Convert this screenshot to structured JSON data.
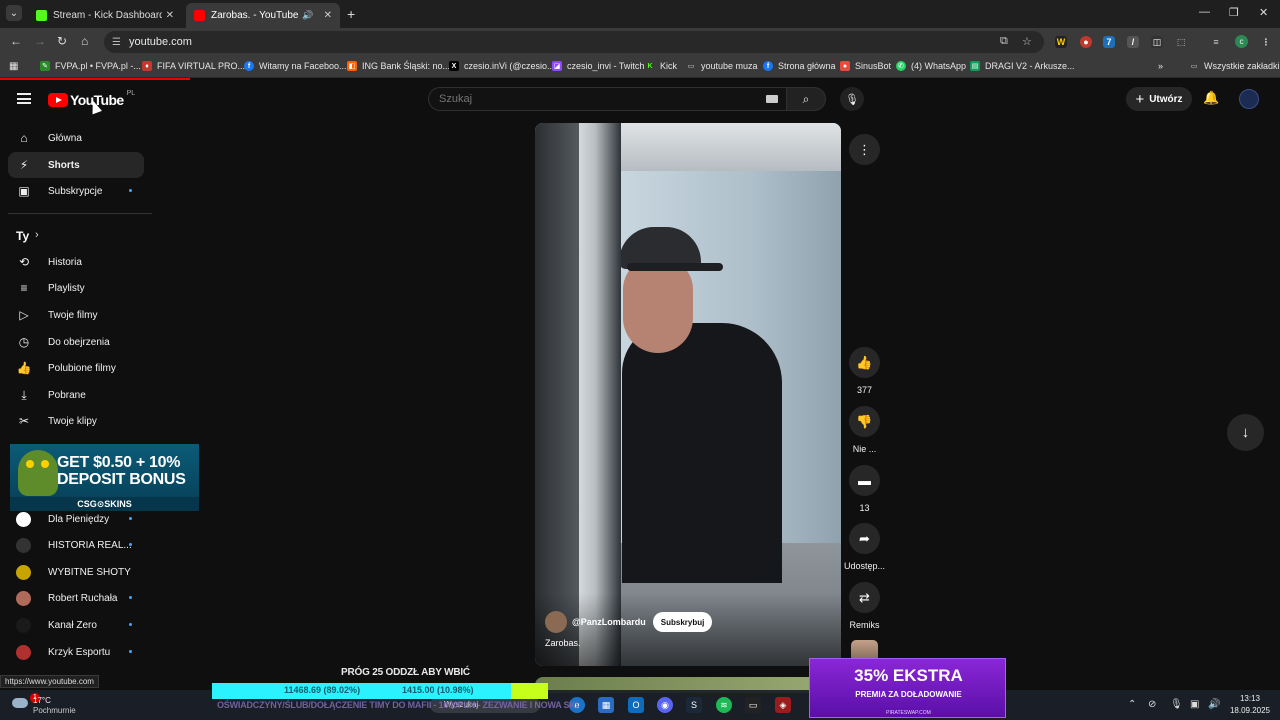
{
  "browser": {
    "tabs": [
      {
        "title": "Stream - Kick Dashboard",
        "favicon_color": "#53fc18"
      },
      {
        "title": "Zarobas. - YouTube",
        "favicon_color": "#ff0000"
      }
    ],
    "address": "youtube.com",
    "bookmarks": [
      {
        "label": "FVPA.pl • FVPA.pl -...",
        "color": "#2a8a2a"
      },
      {
        "label": "FIFA VIRTUAL PRO...",
        "color": "#c0392b"
      },
      {
        "label": "Witamy na Faceboo...",
        "color": "#1877f2"
      },
      {
        "label": "ING Bank Śląski: no...",
        "color": "#ff6200"
      },
      {
        "label": "czesio.inVi (@czesio...",
        "color": "#000000"
      },
      {
        "label": "czesio_invi - Twitch",
        "color": "#9146ff"
      },
      {
        "label": "Kick",
        "color": "#53fc18"
      },
      {
        "label": "youtube muza",
        "color": "#555555"
      },
      {
        "label": "Strona główna",
        "color": "#1877f2"
      },
      {
        "label": "SinusBot",
        "color": "#e74c3c"
      },
      {
        "label": "(4) WhatsApp",
        "color": "#25d366"
      },
      {
        "label": "DRAGI V2 - Arkusze...",
        "color": "#0f9d58"
      }
    ],
    "all_bookmarks": "Wszystkie zakładki",
    "profile_initial": "c"
  },
  "youtube": {
    "logo_text": "YouTube",
    "country": "PL",
    "search_placeholder": "Szukaj",
    "create_label": "Utwórz",
    "nav": [
      {
        "label": "Główna",
        "icon": "⌂"
      },
      {
        "label": "Shorts",
        "icon": "⚡"
      },
      {
        "label": "Subskrypcje",
        "icon": "▣"
      }
    ],
    "you_label": "Ty",
    "you_items": [
      {
        "label": "Historia",
        "icon": "⟲"
      },
      {
        "label": "Playlisty",
        "icon": "≡"
      },
      {
        "label": "Twoje filmy",
        "icon": "▷"
      },
      {
        "label": "Do obejrzenia",
        "icon": "◷"
      },
      {
        "label": "Polubione filmy",
        "icon": "👍"
      },
      {
        "label": "Pobrane",
        "icon": "⤓"
      },
      {
        "label": "Twoje klipy",
        "icon": "✂"
      }
    ],
    "subscriptions": [
      {
        "label": "Dla Pieniędzy",
        "color": "#ffffff"
      },
      {
        "label": "HISTORIA REAL...",
        "color": "#333333"
      },
      {
        "label": "WYBITNE SHOTY",
        "color": "#c8a400"
      },
      {
        "label": "Robert Ruchała",
        "color": "#b06a5a"
      },
      {
        "label": "Kanał Zero",
        "color": "#1a1a1a"
      },
      {
        "label": "Krzyk Esportu",
        "color": "#b03030"
      }
    ]
  },
  "short": {
    "channel": "@PanzLombardu",
    "subscribe_label": "Subskrybuj",
    "title": "Zarobas.",
    "likes": "377",
    "dislike_label": "Nie ...",
    "comments": "13",
    "share_label": "Udostęp...",
    "remix_label": "Remiks"
  },
  "ads": {
    "csg_line1": "GET $0.50 + 10%",
    "csg_line2": "DEPOSIT BONUS",
    "csg_brand": "CSG⊙SKINS",
    "promo_line1": "35% EKSTRA",
    "promo_line2": "PREMIA ZA DOŁADOWANIE",
    "promo_site": "PIRATESWAP.COM"
  },
  "overlay": {
    "goal_text": "PRÓG 25 ODDZŁ ABY WBIĆ",
    "bar_value1": "11468.69 (89.02%)",
    "bar_value2": "1415.00 (10.98%)",
    "bar_fraction": 0.8902,
    "ticker": "OŚWIADCZYNY/ŚLUB/DOŁĄCZENIE TIMY DO MAFII - 1600PLN - ZEZWANIE I NOWA SKI"
  },
  "status_url": "https://www.youtube.com",
  "taskbar": {
    "notification_count": "1",
    "temperature": "17°C",
    "condition": "Pochmurnie",
    "search_label": "Wyszukaj",
    "time": "13:13",
    "date": "18.09.2025"
  }
}
